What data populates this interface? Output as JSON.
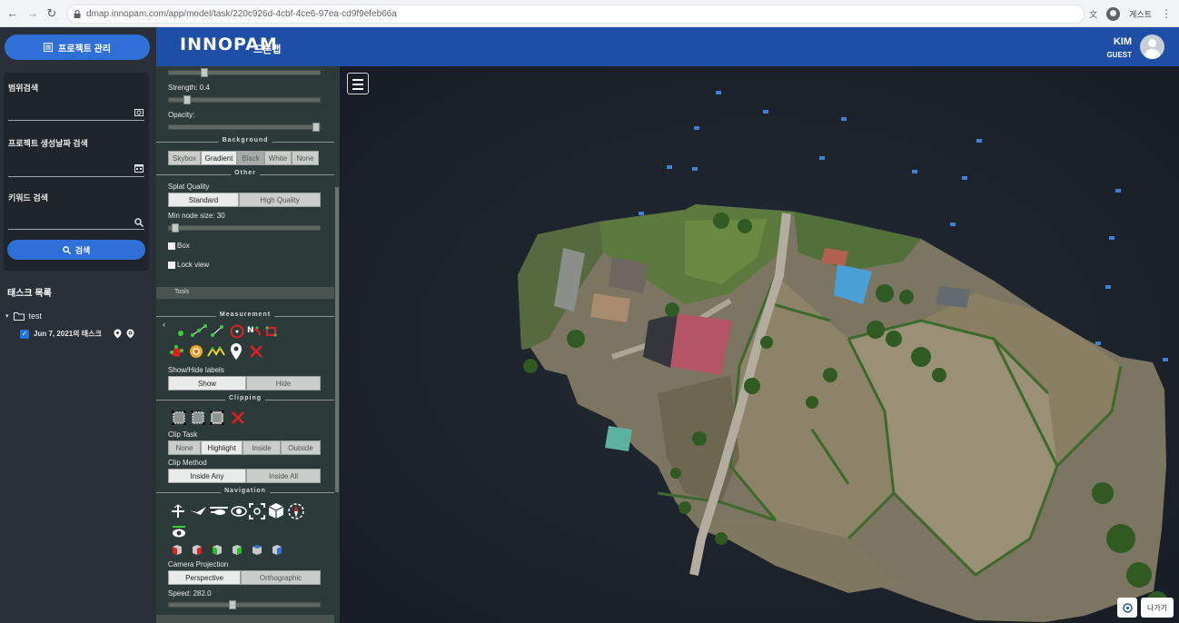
{
  "browser": {
    "url": "dmap.innopam.com/app/model/task/220c926d-4cbf-4ce6-97ea-cd9f9efeb66a",
    "profile_label": "게스트"
  },
  "sidebar": {
    "project_button": "프로젝트 관리",
    "range_search_label": "범위검색",
    "date_search_label": "프로젝트 생성날짜 검색",
    "keyword_search_label": "키워드 검색",
    "search_button": "검색",
    "task_list_title": "태스크 목록",
    "tree": {
      "folder_name": "test",
      "task_name": "Jun 7, 2021의 태스크",
      "task_checked": true
    }
  },
  "header": {
    "logo": "INNOPAM",
    "app_name": "드론맵",
    "user_name": "KIM",
    "user_role": "GUEST"
  },
  "panel": {
    "strength_label": "Strength: 0.4",
    "strength_level": 0.1,
    "top_slider_level": 0.22,
    "opacity_label": "Opacity:",
    "opacity_level": 1.0,
    "background_title": "Background",
    "background_options": [
      "Skybox",
      "Gradient",
      "Black",
      "White",
      "None"
    ],
    "background_selected": "Gradient",
    "other_title": "Other",
    "splat_quality_label": "Splat Quality",
    "splat_quality_options": [
      "Standard",
      "High Quality"
    ],
    "splat_quality_selected": "Standard",
    "min_node_size_label": "Min node size: 30",
    "min_node_size_level": 0.02,
    "box_label": "Box",
    "lock_view_label": "Lock view",
    "tools_label": "Tools",
    "measurement_title": "Measurement",
    "show_hide_labels": "Show/Hide labels",
    "show_button": "Show",
    "hide_button": "Hide",
    "clipping_title": "Clipping",
    "clip_task_label": "Clip Task",
    "clip_task_options": [
      "None",
      "Highlight",
      "Inside",
      "Outside"
    ],
    "clip_task_selected": "Highlight",
    "clip_method_label": "Clip Method",
    "clip_method_options": [
      "Inside Any",
      "Inside All"
    ],
    "clip_method_selected": "Inside Any",
    "navigation_title": "Navigation",
    "camera_projection_label": "Camera Projection",
    "camera_projection_options": [
      "Perspective",
      "Orthographic"
    ],
    "camera_projection_selected": "Perspective",
    "speed_label": "Speed: 282.0",
    "speed_level": 0.42
  },
  "viewer": {
    "exit_button": "나가기"
  },
  "colors": {
    "header_blue": "#1e4fa6",
    "button_blue": "#2f6fd8",
    "sidebar_bg": "#2a3038",
    "panel_bg": "#2c3a3a",
    "viewer_bg": "#1d232d"
  }
}
